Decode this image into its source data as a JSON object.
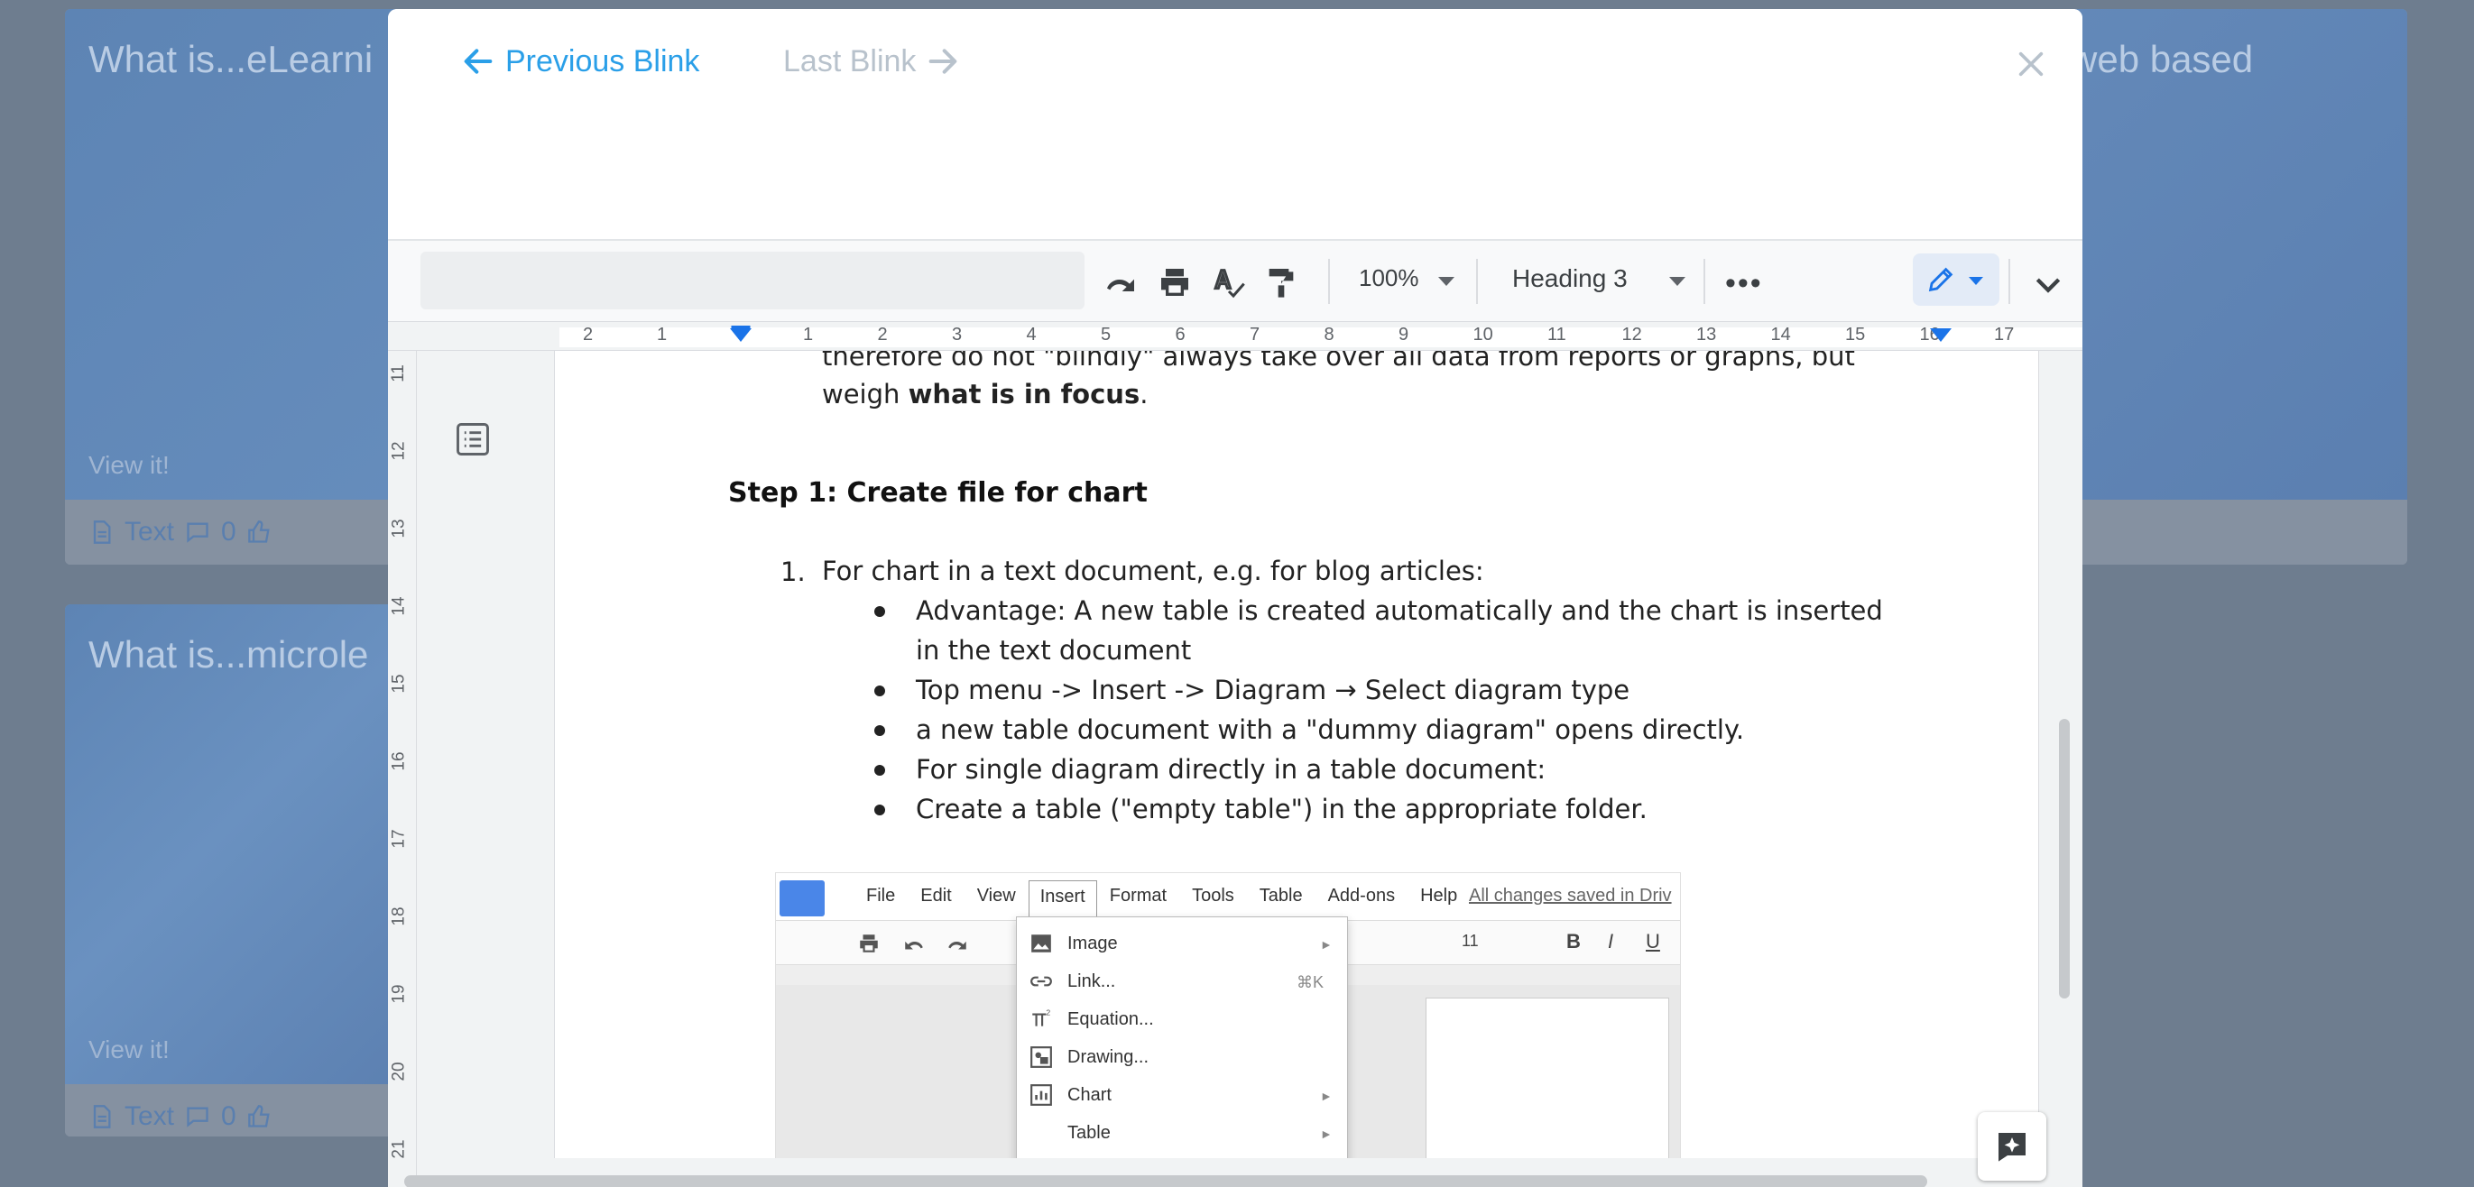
{
  "background": {
    "cards": [
      {
        "title": "What is...eLearni",
        "view_label": "View it!",
        "type_label": "Text",
        "comments": "0"
      },
      {
        "title": "What is...microle",
        "view_label": "View it!",
        "type_label": "Text",
        "comments": "0"
      },
      {
        "title": "web based"
      }
    ]
  },
  "modal": {
    "prev_label": "Previous Blink",
    "next_label": "Last Blink"
  },
  "toolbar": {
    "zoom": "100%",
    "style": "Heading 3"
  },
  "ruler": {
    "h_ticks": [
      "2",
      "1",
      "1",
      "2",
      "3",
      "4",
      "5",
      "6",
      "7",
      "8",
      "9",
      "10",
      "11",
      "12",
      "13",
      "14",
      "15",
      "16",
      "17"
    ],
    "v_ticks": [
      "11",
      "12",
      "13",
      "14",
      "15",
      "16",
      "17",
      "18",
      "19",
      "20",
      "21"
    ]
  },
  "document": {
    "intro_line1": "therefore do not \"blindly\" always take over all data from reports or graphs, but",
    "intro_line2_prefix": "weigh ",
    "intro_line2_bold": "what is in focus",
    "intro_line2_suffix": ".",
    "step_heading": "Step 1: Create file for chart",
    "list_number": "1.",
    "list_item": "For chart in a text document, e.g. for blog articles:",
    "bullets": [
      "Advantage: A new table is created automatically and the chart is inserted",
      "in the text document",
      "Top menu -> Insert -> Diagram → Select diagram type",
      "a new table document with a \"dummy diagram\" opens directly.",
      "For single diagram directly in a table document:",
      "Create a table (\"empty table\") in the appropriate folder."
    ]
  },
  "embedded_screenshot": {
    "menu": [
      "File",
      "Edit",
      "View",
      "Insert",
      "Format",
      "Tools",
      "Table",
      "Add-ons",
      "Help"
    ],
    "saved_text": "All changes saved in Driv",
    "font_size": "11",
    "format_buttons": [
      "B",
      "I",
      "U"
    ],
    "dropdown": [
      {
        "label": "Image",
        "has_submenu": true
      },
      {
        "label": "Link...",
        "shortcut": "⌘K"
      },
      {
        "label": "Equation..."
      },
      {
        "label": "Drawing..."
      },
      {
        "label": "Chart",
        "has_submenu": true
      },
      {
        "label": "Table",
        "has_submenu": true
      }
    ]
  },
  "colors": {
    "accent": "#2a9fe8",
    "disabled": "#b8c2cc",
    "backdrop": "#6e7d8f"
  }
}
